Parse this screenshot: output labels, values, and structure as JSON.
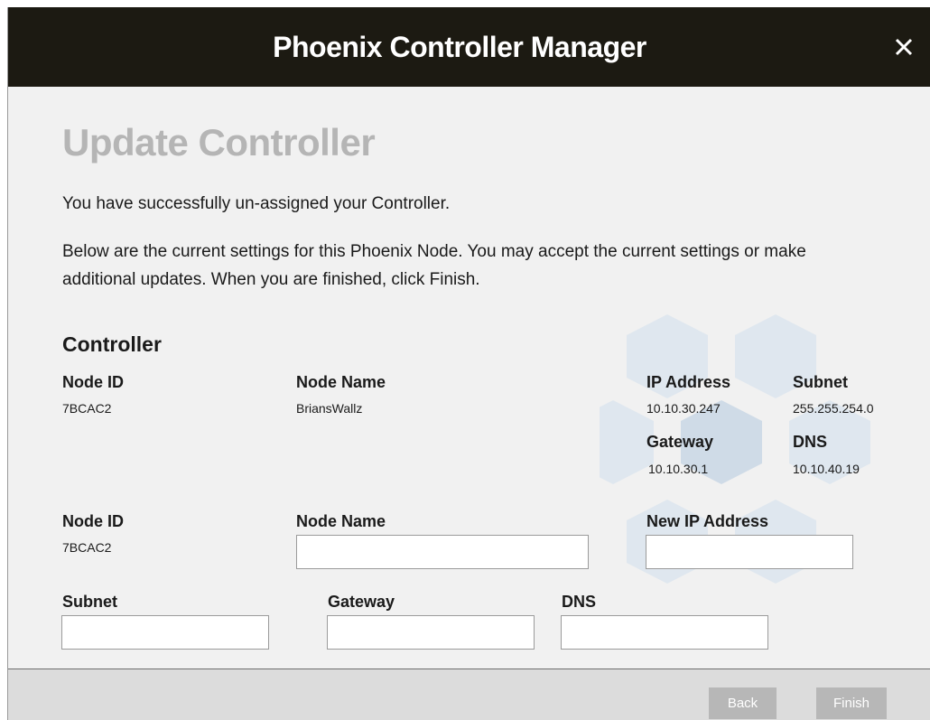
{
  "window": {
    "title": "Phoenix Controller Manager"
  },
  "page": {
    "heading": "Update Controller",
    "message1": "You have successfully un-assigned your Controller.",
    "message2": "Below are the current settings for this Phoenix Node.  You may accept the current settings or make additional updates.  When you are finished, click Finish."
  },
  "current": {
    "section_title": "Controller",
    "node_id_label": "Node ID",
    "node_id": "7BCAC2",
    "node_name_label": "Node Name",
    "node_name": "BriansWallz",
    "ip_label": "IP Address",
    "ip": "10.10.30.247",
    "subnet_label": "Subnet",
    "subnet": "255.255.254.0",
    "gateway_label": "Gateway",
    "gateway": "10.10.30.1",
    "dns_label": "DNS",
    "dns": "10.10.40.19"
  },
  "form": {
    "node_id_label": "Node ID",
    "node_id": "7BCAC2",
    "node_name_label": "Node Name",
    "node_name_value": "",
    "new_ip_label": "New IP Address",
    "new_ip_value": "",
    "subnet_label": "Subnet",
    "subnet_value": "",
    "gateway_label": "Gateway",
    "gateway_value": "",
    "dns_label": "DNS",
    "dns_value": ""
  },
  "footer": {
    "back_label": "Back",
    "finish_label": "Finish"
  },
  "icons": {
    "close": "close-icon",
    "background": "hexagon-pattern"
  },
  "colors": {
    "titlebar": "#1c1a12",
    "heading": "#b5b5b5",
    "button_disabled": "#b7b7b7",
    "hexagon": "#dde6ee"
  }
}
